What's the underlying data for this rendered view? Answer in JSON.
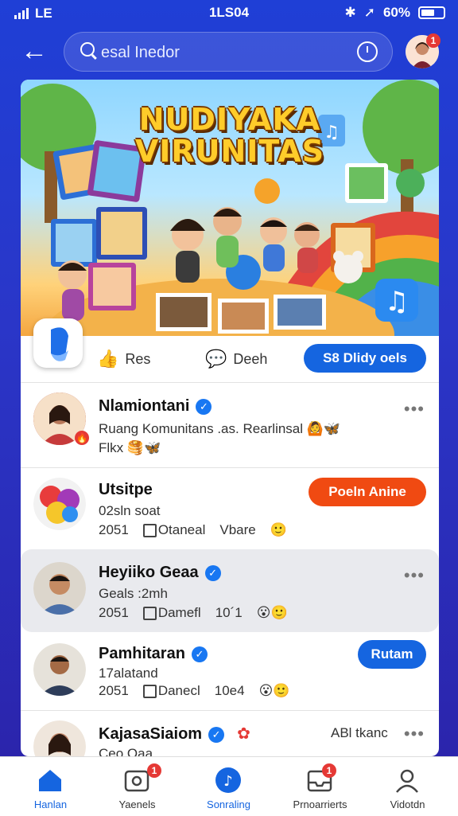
{
  "status": {
    "time": "1LS04",
    "carrier": "LE",
    "battery": "60%",
    "battery_level": 0.6
  },
  "header": {
    "search_placeholder": "esal Inedor",
    "avatar_badge": "1"
  },
  "banner": {
    "title_line1": "NUDIYAKA",
    "title_line2": "VIRUNITAS"
  },
  "actions": {
    "like": "Res",
    "comment": "Deeh",
    "cta": "S8 Dlidy oels"
  },
  "feed": [
    {
      "name": "Nlamiontani",
      "verified": true,
      "line1": "Ruang Komunitans .as. Rearlinsal",
      "line2": "Flkx",
      "bg": "#ffffff"
    },
    {
      "name": "Utsitpe",
      "verified": false,
      "line1": "02sln soat",
      "meta": [
        "2051",
        "Otaneal",
        "Vbare"
      ],
      "cta": "Poeln Anine",
      "bg": "#ffffff"
    },
    {
      "name": "Heyiiko Geaa",
      "verified": true,
      "line1": "Geals :2mh",
      "meta": [
        "2051",
        "Damefl",
        "10´1"
      ],
      "bg": "#e9eaee"
    },
    {
      "name": "Pamhitaran",
      "verified": true,
      "line1": "17alatand",
      "meta": [
        "2051",
        "Danecl",
        "10e4"
      ],
      "cta": "Rutam",
      "bg": "#ffffff"
    },
    {
      "name": "KajasaSiaiom",
      "verified": true,
      "line1": "Ceo Oaa",
      "extra": "ABl tkanc",
      "bg": "#ffffff"
    }
  ],
  "nav": [
    {
      "label": "Hanlan",
      "badge": ""
    },
    {
      "label": "Yaenels",
      "badge": "1"
    },
    {
      "label": "Sonraling",
      "badge": ""
    },
    {
      "label": "Prnoarrierts",
      "badge": "1"
    },
    {
      "label": "Vidotdn",
      "badge": ""
    }
  ],
  "colors": {
    "accent": "#1565e0",
    "orange": "#f04a12",
    "background": "#2a36c8",
    "badge": "#e53935"
  }
}
